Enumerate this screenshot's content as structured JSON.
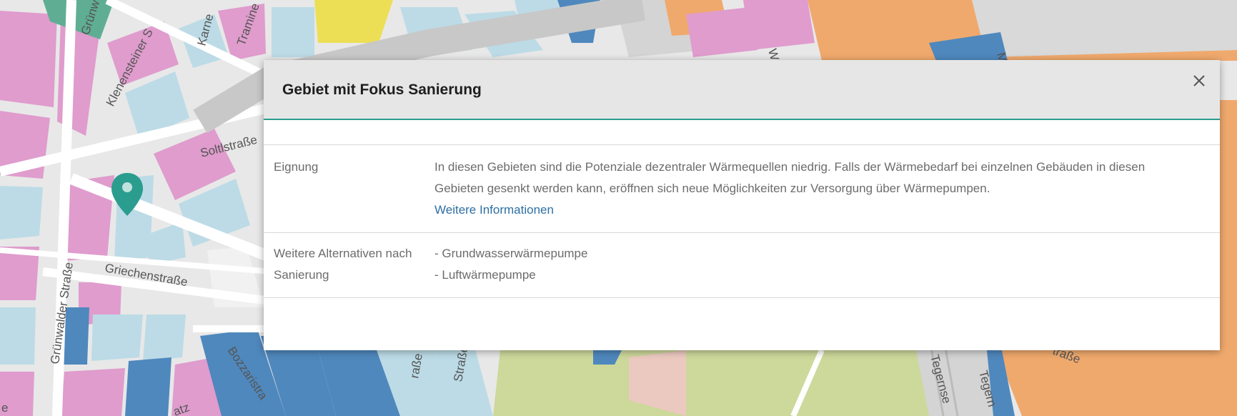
{
  "map": {
    "street_labels": [
      "Grünw",
      "Klenensteiner S",
      "Karne",
      "Tramine",
      "Soltlstraße",
      "Griechenstraße",
      "Grünwalder Straße",
      "Bozzaristra",
      "raße",
      "Straße",
      "Tegernse",
      "Tegern",
      "e",
      "traße",
      "W",
      "M",
      "atz"
    ],
    "marker_icon": "location-pin-icon",
    "colors": {
      "pink": "#df9ccd",
      "light_blue": "#bcdbe6",
      "blue": "#4f88bd",
      "orange": "#f0a96d",
      "green_park": "#cdd89b",
      "teal": "#2a9d8f",
      "yellow": "#ecdf55",
      "gray": "#d4d4d4"
    }
  },
  "popup": {
    "title": "Gebiet mit Fokus Sanierung",
    "close_icon": "close-icon",
    "rows": [
      {
        "label": "Eignung",
        "text": "In diesen Gebieten sind die Potenziale dezentraler Wärmequellen niedrig. Falls der Wärmebedarf bei einzelnen Gebäuden in diesen Gebieten gesenkt werden kann, eröffnen sich neue Möglichkeiten zur Versorgung über Wärmepumpen.",
        "link": "Weitere Informationen"
      },
      {
        "label": "Weitere Alternativen nach Sanierung",
        "items": [
          "- Grundwasserwärmepumpe",
          "- Luftwärmepumpe"
        ]
      }
    ]
  }
}
